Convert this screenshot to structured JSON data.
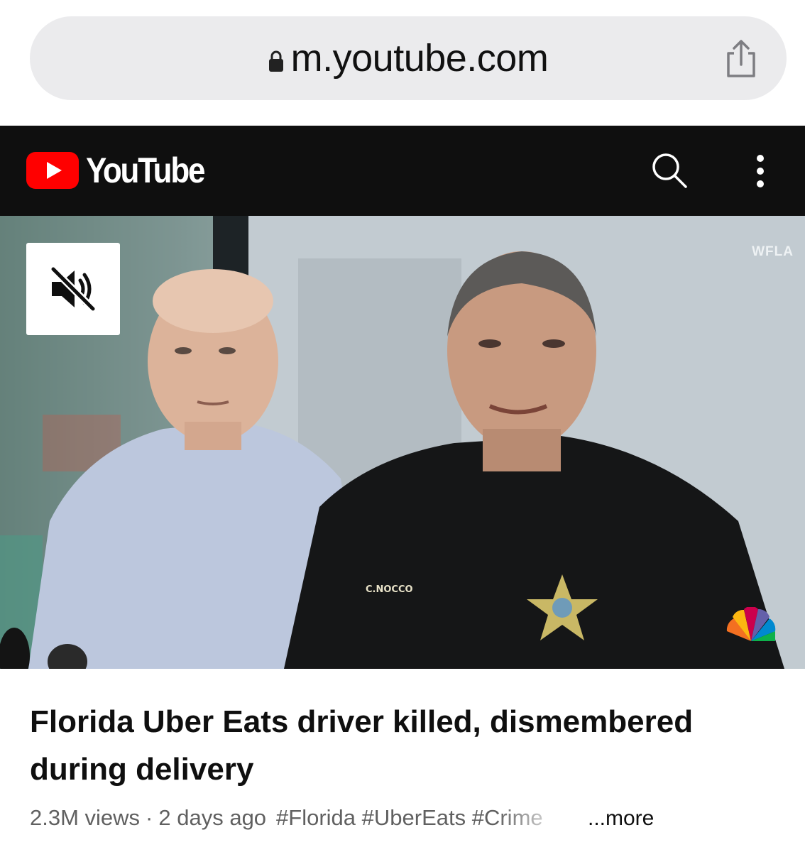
{
  "browser": {
    "url": "m.youtube.com"
  },
  "header": {
    "logo_text": "YouTube"
  },
  "video": {
    "channel_watermark": "WFLA",
    "badge_text": "C.NOCCO"
  },
  "details": {
    "title": "Florida Uber Eats driver killed, dismembered during delivery",
    "views": "2.3M views",
    "separator": "·",
    "age": "2 days ago",
    "hashtags": "#Florida #UberEats #Crime",
    "more_label": "...more"
  },
  "colors": {
    "brand_red": "#ff0000",
    "header_bg": "#0f0f0f",
    "meta_text": "#606060"
  }
}
